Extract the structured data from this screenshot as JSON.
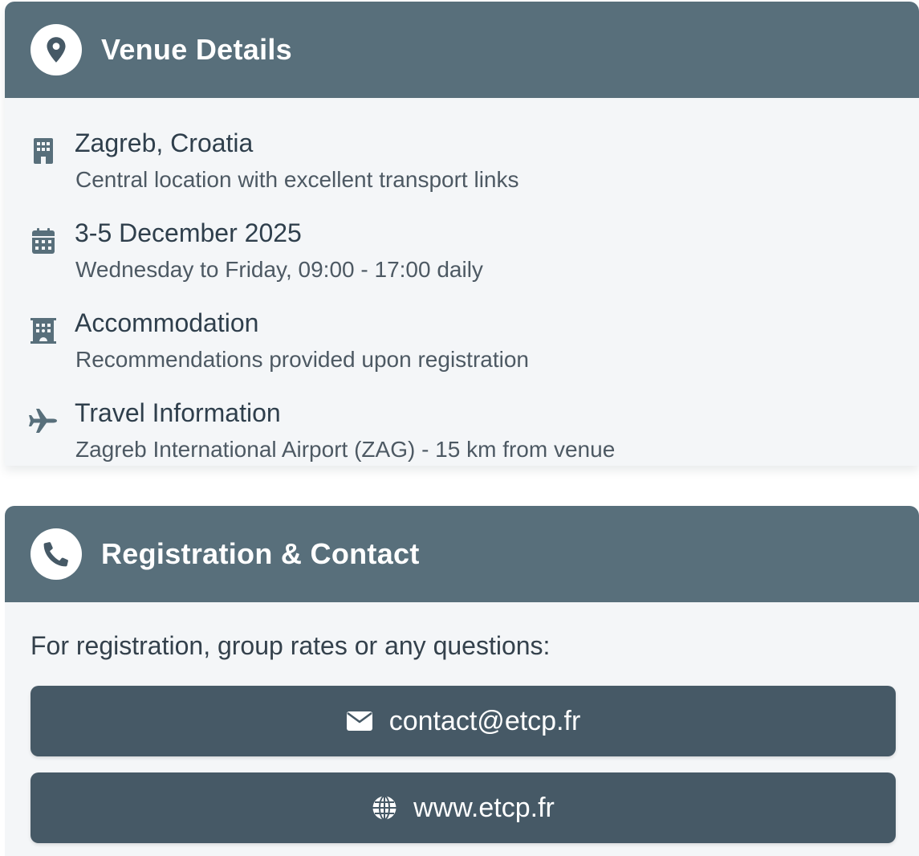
{
  "colors": {
    "header_bg": "#586f7b",
    "card_bg": "#f4f6f8",
    "button_bg": "#465966",
    "icon": "#586f7b",
    "title_text": "#2f3f4c",
    "body_text": "#4d5963"
  },
  "venue": {
    "header_icon": "map-pin-icon",
    "title": "Venue Details",
    "items": [
      {
        "icon": "building-icon",
        "title": "Zagreb, Croatia",
        "subtitle": "Central location with excellent transport links"
      },
      {
        "icon": "calendar-icon",
        "title": "3-5 December 2025",
        "subtitle": "Wednesday to Friday, 09:00 - 17:00 daily"
      },
      {
        "icon": "hotel-icon",
        "title": "Accommodation",
        "subtitle": "Recommendations provided upon registration"
      },
      {
        "icon": "plane-icon",
        "title": "Travel Information",
        "subtitle": "Zagreb International Airport (ZAG) - 15 km from venue"
      }
    ]
  },
  "contact": {
    "header_icon": "phone-icon",
    "title": "Registration & Contact",
    "intro": "For registration, group rates or any questions:",
    "email_label": "contact@etcp.fr",
    "website_label": "www.etcp.fr"
  }
}
